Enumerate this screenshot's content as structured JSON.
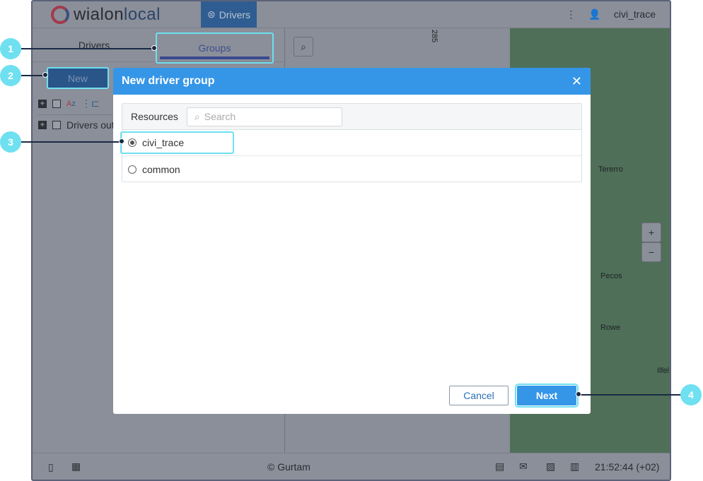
{
  "header": {
    "logo": "wialonlocal",
    "drivers_tab": "Drivers",
    "user": "civi_trace"
  },
  "left_panel": {
    "tabs": [
      {
        "label": "Drivers"
      },
      {
        "label": "Groups"
      }
    ],
    "new_button": "New",
    "row_label": "Drivers out"
  },
  "map": {
    "cities": [
      "Tererro",
      "Pecos",
      "Rowe",
      "Ilfel"
    ],
    "road_label": "285",
    "zoom_in": "+",
    "zoom_out": "−"
  },
  "footer": {
    "copyright": "© Gurtam",
    "time": "21:52:44 (+02)"
  },
  "modal": {
    "title": "New driver group",
    "resources_label": "Resources",
    "search_placeholder": "Search",
    "resources": [
      {
        "name": "civi_trace",
        "selected": true
      },
      {
        "name": "common",
        "selected": false
      }
    ],
    "cancel": "Cancel",
    "next": "Next"
  },
  "callouts": [
    "1",
    "2",
    "3",
    "4"
  ],
  "colors": {
    "accent": "#3596e8",
    "highlight": "#6ee0f0"
  }
}
